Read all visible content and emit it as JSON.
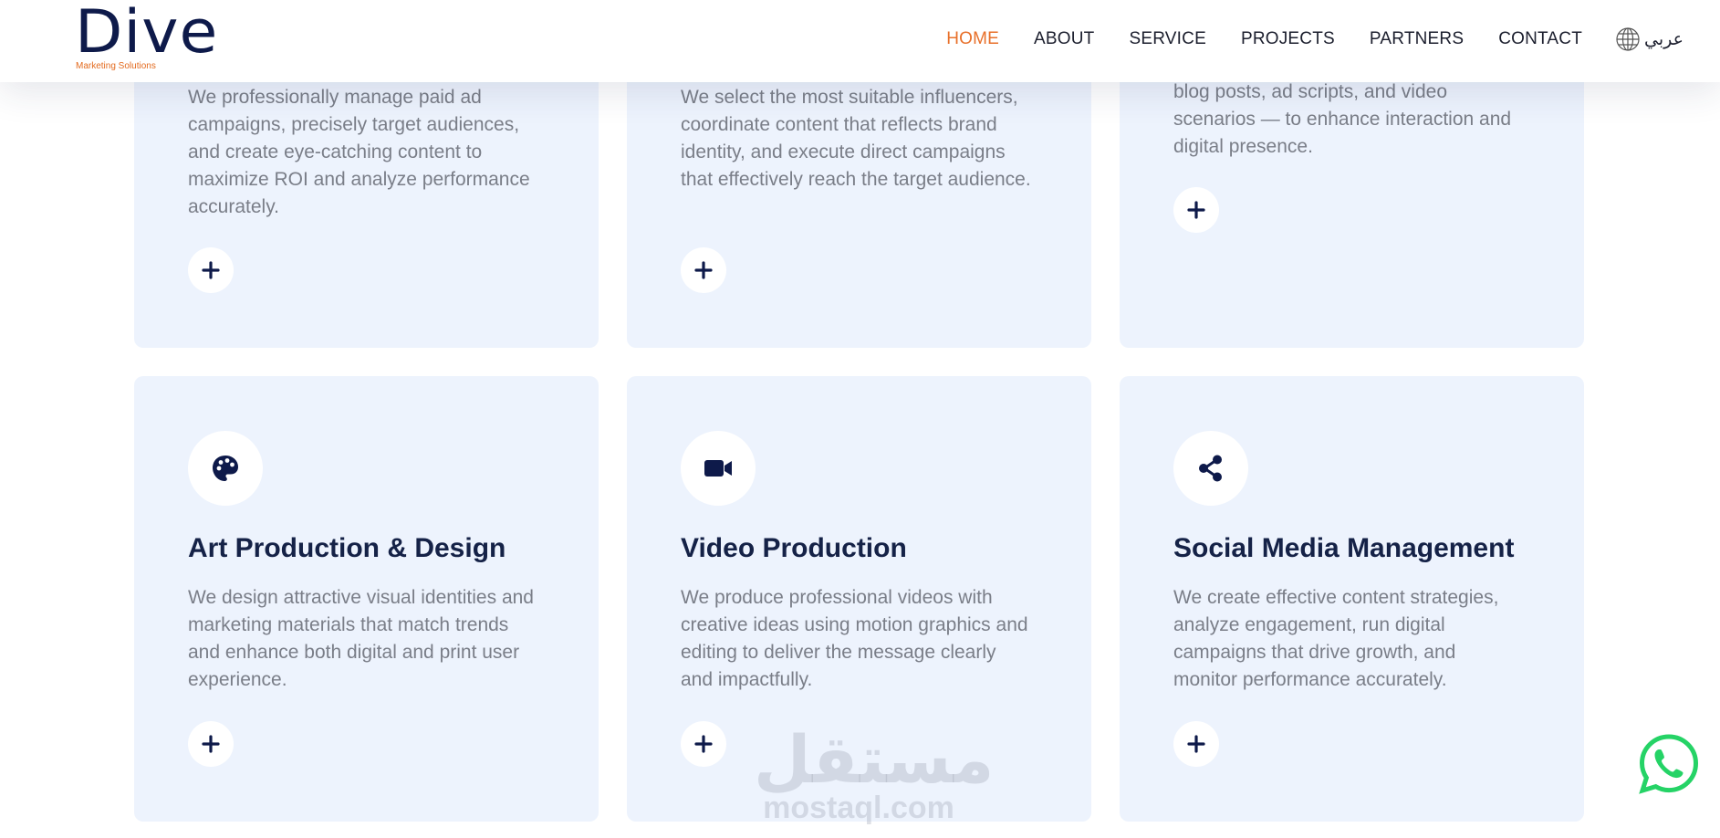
{
  "brand": {
    "name": "Dive",
    "tagline": "Marketing Solutions",
    "color": "#0e1a4a",
    "accent": "#e8702a"
  },
  "nav": {
    "items": [
      {
        "label": "HOME",
        "active": true
      },
      {
        "label": "ABOUT",
        "active": false
      },
      {
        "label": "SERVICE",
        "active": false
      },
      {
        "label": "PROJECTS",
        "active": false
      },
      {
        "label": "PARTNERS",
        "active": false
      },
      {
        "label": "CONTACT",
        "active": false
      }
    ],
    "language": {
      "icon": "globe-icon",
      "label": "عربي"
    }
  },
  "services_top": [
    {
      "text": "We professionally manage paid ad campaigns, precisely target audiences, and create eye-catching content to maximize ROI and analyze performance accurately.",
      "action_icon": "plus-icon"
    },
    {
      "text": "We select the most suitable influencers, coordinate content that reflects brand identity, and execute direct campaigns that effectively reach the target audience.",
      "action_icon": "plus-icon"
    },
    {
      "text": "blog posts, ad scripts, and video scenarios — to enhance interaction and digital presence.",
      "action_icon": "plus-icon"
    }
  ],
  "services_bottom": [
    {
      "icon": "palette-icon",
      "title": "Art Production & Design",
      "text": "We design attractive visual identities and marketing materials that match trends and enhance both digital and print user experience.",
      "action_icon": "plus-icon"
    },
    {
      "icon": "video-camera-icon",
      "title": "Video Production",
      "text": "We produce professional videos with creative ideas using motion graphics and editing to deliver the message clearly and impactfully.",
      "action_icon": "plus-icon"
    },
    {
      "icon": "share-icon",
      "title": "Social Media Management",
      "text": "We create effective content strategies, analyze engagement, run digital campaigns that drive growth, and monitor performance accurately.",
      "action_icon": "plus-icon"
    }
  ],
  "watermark": {
    "arabic": "مستقل",
    "latin": "mostaql.com"
  },
  "floating": {
    "whatsapp_icon": "whatsapp-icon",
    "color": "#25d366"
  },
  "colors": {
    "card_bg": "#edf3fd",
    "title": "#152247",
    "body_text": "#7a7e88"
  }
}
